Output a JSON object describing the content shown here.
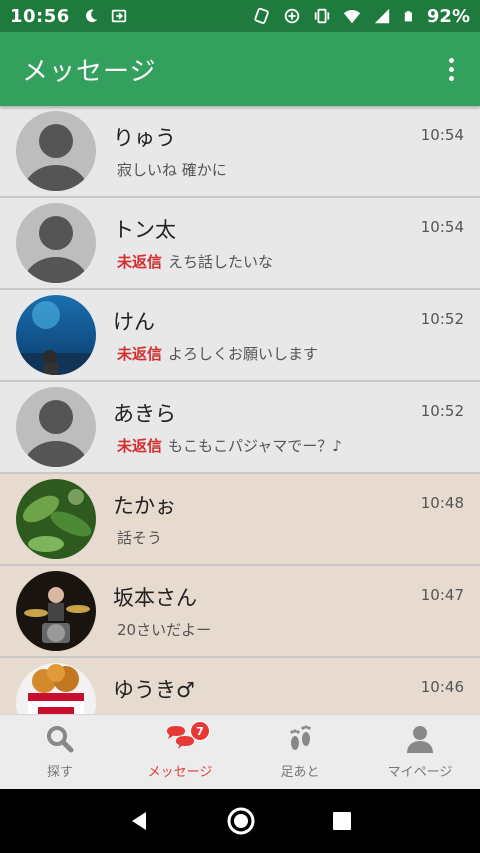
{
  "status_bar": {
    "time": "10:56",
    "battery_percent": "92%",
    "icons": [
      "moon-icon",
      "cast-icon",
      "nfc-icon",
      "data-saver-icon",
      "vibrate-icon",
      "wifi-icon",
      "signal-icon",
      "battery-icon"
    ]
  },
  "app_bar": {
    "title": "メッセージ",
    "menu_icon": "more-vertical-icon"
  },
  "conversations": [
    {
      "name": "りゅう",
      "time": "10:54",
      "status": "",
      "message": "寂しいね 確かに",
      "avatar": "default",
      "bg": "gray"
    },
    {
      "name": "トン太",
      "time": "10:54",
      "status": "未返信",
      "message": "えち話したいな",
      "avatar": "default",
      "bg": "gray"
    },
    {
      "name": "けん",
      "time": "10:52",
      "status": "未返信",
      "message": "よろしくお願いします",
      "avatar": "aquarium-photo",
      "bg": "gray"
    },
    {
      "name": "あきら",
      "time": "10:52",
      "status": "未返信",
      "message": "もこもこパジャマでー？♪",
      "avatar": "default",
      "bg": "gray"
    },
    {
      "name": "たかぉ",
      "time": "10:48",
      "status": "",
      "message": "話そう",
      "avatar": "plants-photo",
      "bg": "beige"
    },
    {
      "name": "坂本さん",
      "time": "10:47",
      "status": "",
      "message": "20さいだよー",
      "avatar": "drummer-photo",
      "bg": "beige"
    },
    {
      "name": "ゆうき♂",
      "time": "10:46",
      "status": "",
      "message": "",
      "avatar": "fried-chicken-photo",
      "bg": "beige"
    }
  ],
  "tabs": [
    {
      "label": "探す",
      "icon": "search-icon",
      "active": false
    },
    {
      "label": "メッセージ",
      "icon": "chat-bubbles-icon",
      "active": true,
      "badge": "7"
    },
    {
      "label": "足あと",
      "icon": "footprints-icon",
      "active": false
    },
    {
      "label": "マイページ",
      "icon": "person-icon",
      "active": false
    }
  ],
  "nav_bar": [
    "back-icon",
    "home-icon",
    "recents-icon"
  ],
  "colors": {
    "status_bar": "#1f7a3e",
    "app_bar": "#34a05e",
    "unreplied": "#d32f2f",
    "active_tab": "#e53935",
    "read_row": "#e8e8e8",
    "older_row": "#e7dbd0"
  }
}
